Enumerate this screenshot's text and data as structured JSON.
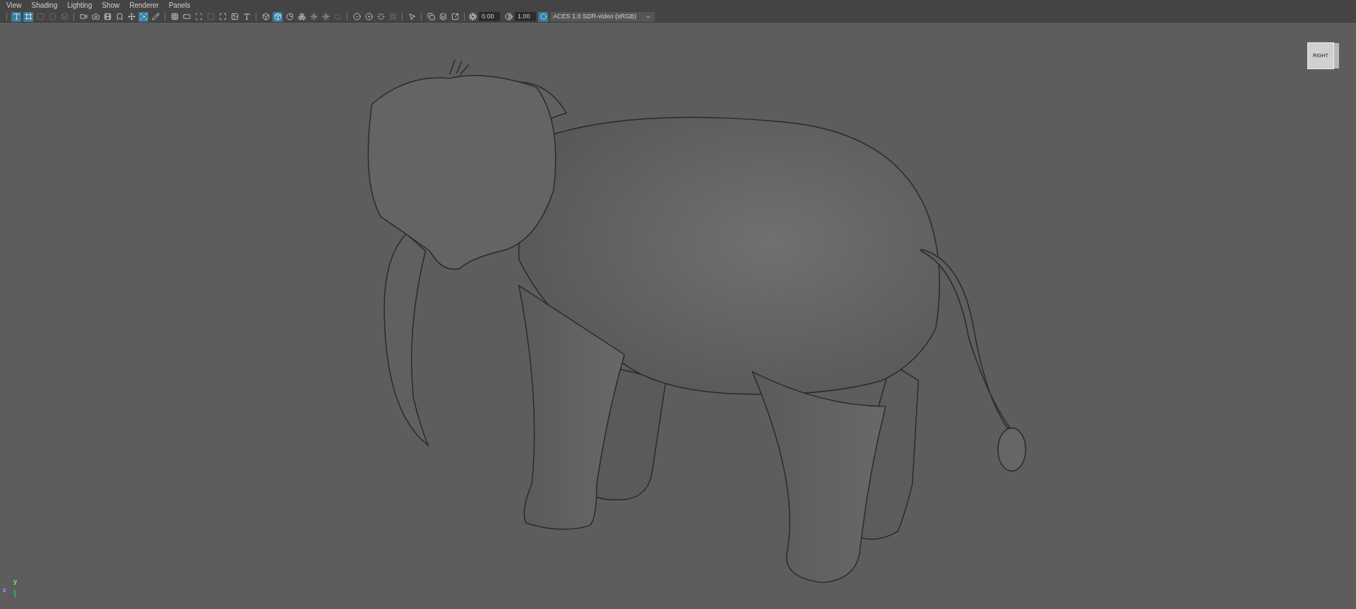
{
  "menu": [
    "View",
    "Shading",
    "Lighting",
    "Show",
    "Renderer",
    "Panels"
  ],
  "toolbar": {
    "buttons": [
      {
        "selected": true,
        "disabled": false
      },
      {
        "selected": true,
        "disabled": false
      },
      {
        "selected": false,
        "disabled": true
      },
      {
        "selected": false,
        "disabled": true
      },
      {
        "selected": false,
        "disabled": true
      },
      {
        "selected": false,
        "disabled": false
      },
      {
        "selected": false,
        "disabled": false
      },
      {
        "selected": false,
        "disabled": false
      },
      {
        "selected": false,
        "disabled": false
      },
      {
        "selected": false,
        "disabled": false
      },
      {
        "selected": true,
        "disabled": false
      },
      {
        "selected": false,
        "disabled": false
      },
      {
        "selected": false,
        "disabled": false
      },
      {
        "selected": false,
        "disabled": false
      },
      {
        "selected": false,
        "disabled": false
      },
      {
        "selected": false,
        "disabled": true
      },
      {
        "selected": false,
        "disabled": false
      },
      {
        "selected": false,
        "disabled": false
      },
      {
        "selected": false,
        "disabled": false
      },
      {
        "selected": false,
        "disabled": false
      },
      {
        "selected": true,
        "disabled": false
      },
      {
        "selected": false,
        "disabled": false
      },
      {
        "selected": false,
        "disabled": false
      },
      {
        "selected": false,
        "disabled": false
      },
      {
        "selected": false,
        "disabled": false
      },
      {
        "selected": false,
        "disabled": true
      },
      {
        "selected": false,
        "disabled": false
      },
      {
        "selected": false,
        "disabled": false
      },
      {
        "selected": false,
        "disabled": false
      },
      {
        "selected": false,
        "disabled": true
      },
      {
        "selected": false,
        "disabled": false
      },
      {
        "selected": false,
        "disabled": false
      },
      {
        "selected": false,
        "disabled": false
      },
      {
        "selected": false,
        "disabled": false
      }
    ],
    "exposure": "0.00",
    "gamma": "1.00",
    "color_management": {
      "on": true
    },
    "color_space": "ACES 1.0 SDR-video (sRGB)"
  },
  "view_cube": {
    "face": "RIGHT"
  },
  "axis_gizmo": {
    "labels": [
      "y",
      "z"
    ]
  }
}
